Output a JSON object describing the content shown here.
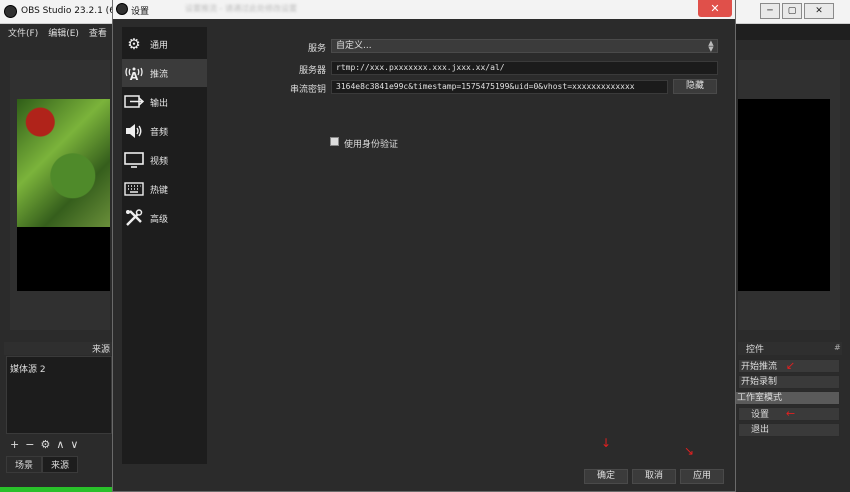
{
  "main_window": {
    "title": "OBS Studio 23.2.1 (6",
    "controls": {
      "minimize": "─",
      "maximize": "▢",
      "close": "✕"
    },
    "menu": [
      "文件(F)",
      "编辑(E)",
      "查看"
    ]
  },
  "sources": {
    "title": "来源",
    "items": [
      "媒体源 2"
    ],
    "toolbar": [
      "+",
      "−",
      "⚙",
      "∧",
      "∨"
    ]
  },
  "dock_tabs": [
    "场景",
    "来源"
  ],
  "controls_dock": {
    "title": "控件",
    "pin": "#",
    "buttons": [
      "开始推流",
      "开始录制",
      "工作室模式",
      "设置",
      "退出"
    ]
  },
  "settings_dialog": {
    "title": "设置",
    "title_ghost": "设置推流 - 请通过此处修改设置",
    "close": "✕",
    "nav": [
      {
        "label": "通用",
        "icon": "gear-icon",
        "glyph": "⚙"
      },
      {
        "label": "推流",
        "icon": "broadcast-icon",
        "glyph": "A"
      },
      {
        "label": "输出",
        "icon": "output-icon",
        "glyph": "⇥"
      },
      {
        "label": "音频",
        "icon": "speaker-icon",
        "glyph": "🔈"
      },
      {
        "label": "视频",
        "icon": "monitor-icon",
        "glyph": "▭"
      },
      {
        "label": "热键",
        "icon": "keyboard-icon",
        "glyph": "⌨"
      },
      {
        "label": "高级",
        "icon": "tools-icon",
        "glyph": "✂"
      }
    ],
    "service_label": "服务",
    "service_value": "自定义...",
    "server_label": "服务器",
    "server_value": "rtmp://xxx.pxxxxxxx.xxx.jxxx.xx/al/",
    "key_label": "串流密钥",
    "key_value": "3164e8c3841e99c&timestamp=1575475199&uid=0&vhost=xxxxxxxxxxxxx",
    "hide_button": "隐藏",
    "auth_label": "使用身份验证",
    "buttons": {
      "ok": "确定",
      "cancel": "取消",
      "apply": "应用"
    }
  },
  "annotation": {
    "arrow": "↙"
  },
  "colors": {
    "accent_red": "#e02020",
    "progress_green": "#29c02a",
    "dark_bg": "#2b2b2b"
  }
}
